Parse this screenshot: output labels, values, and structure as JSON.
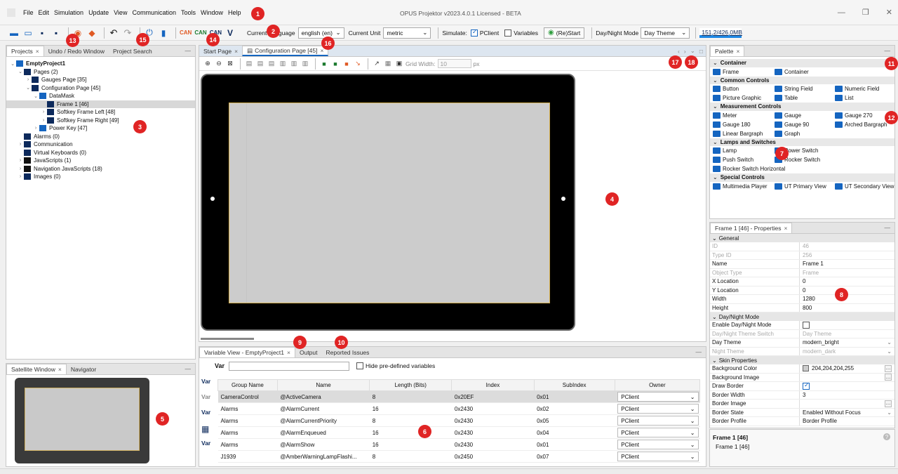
{
  "window": {
    "title": "OPUS Projektor v2023.4.0.1 Licensed - BETA"
  },
  "menu": [
    "File",
    "Edit",
    "Simulation",
    "Update",
    "View",
    "Communication",
    "Tools",
    "Window",
    "Help"
  ],
  "toolbar": {
    "can_labels": [
      "CAN",
      "CAN",
      "CAN"
    ],
    "language_label": "Current Language",
    "language_value": "english (en)",
    "unit_label": "Current Unit",
    "unit_value": "metric",
    "simulate_label": "Simulate:",
    "pclient_label": "PClient",
    "variables_label": "Variables",
    "restart_label": "(Re)Start",
    "daynight_label": "Day/Night Mode",
    "daynight_value": "Day Theme",
    "memory": "151,2/426,0MB"
  },
  "badges": [
    "1",
    "2",
    "3",
    "4",
    "5",
    "6",
    "7",
    "8",
    "9",
    "10",
    "11",
    "12",
    "13",
    "14",
    "15",
    "16",
    "17",
    "18"
  ],
  "projects": {
    "tabs": [
      "Projects",
      "Undo / Redo Window",
      "Project Search"
    ],
    "tree": [
      {
        "label": "EmptyProject1",
        "bold": true
      },
      {
        "label": "Pages (2)"
      },
      {
        "label": "Gauges Page [35]"
      },
      {
        "label": "Configuration Page [45]"
      },
      {
        "label": "DataMask"
      },
      {
        "label": "Frame 1 [46]"
      },
      {
        "label": "Softkey Frame Left [48]"
      },
      {
        "label": "Softkey Frame Right [49]"
      },
      {
        "label": "Power Key [47]"
      },
      {
        "label": "Alarms (0)"
      },
      {
        "label": "Communication"
      },
      {
        "label": "Virtual Keyboards (0)"
      },
      {
        "label": "JavaScripts (1)"
      },
      {
        "label": "Navigation JavaScripts (18)"
      },
      {
        "label": "Images (0)"
      }
    ]
  },
  "satellite": {
    "tabs": [
      "Satellite Window",
      "Navigator"
    ]
  },
  "editor": {
    "tabs": [
      "Start Page",
      "Configuration Page [45]"
    ],
    "grid_label": "Grid Width:",
    "grid_value": "10",
    "grid_unit": "px"
  },
  "bottom": {
    "tabs": [
      "Variable View - EmptyProject1",
      "Output",
      "Reported Issues"
    ],
    "var_label": "Var",
    "hide_label": "Hide pre-defined variables",
    "columns": [
      "Group Name",
      "Name",
      "Length (Bits)",
      "Index",
      "SubIndex",
      "Owner"
    ],
    "rows": [
      [
        "CameraControl",
        "@ActiveCamera",
        "8",
        "0x20EF",
        "0x01",
        "PClient"
      ],
      [
        "Alarms",
        "@AlarmCurrent",
        "16",
        "0x2430",
        "0x02",
        "PClient"
      ],
      [
        "Alarms",
        "@AlarmCurrentPriority",
        "8",
        "0x2430",
        "0x05",
        "PClient"
      ],
      [
        "Alarms",
        "@AlarmEnqueued",
        "16",
        "0x2430",
        "0x04",
        "PClient"
      ],
      [
        "Alarms",
        "@AlarmShow",
        "16",
        "0x2430",
        "0x01",
        "PClient"
      ],
      [
        "J1939",
        "@AmberWarningLampFlashi...",
        "8",
        "0x2450",
        "0x07",
        "PClient"
      ]
    ]
  },
  "palette": {
    "tab": "Palette",
    "sections": [
      {
        "title": "Container",
        "rows": [
          [
            "Frame",
            "Container"
          ]
        ]
      },
      {
        "title": "Common Controls",
        "rows": [
          [
            "Button",
            "String Field",
            "Numeric Field"
          ],
          [
            "Picture Graphic",
            "Table",
            "List"
          ]
        ]
      },
      {
        "title": "Measurement Controls",
        "rows": [
          [
            "Meter",
            "Gauge",
            "Gauge 270"
          ],
          [
            "Gauge 180",
            "Gauge 90",
            "Arched Bargraph"
          ],
          [
            "Linear Bargraph",
            "Graph"
          ]
        ]
      },
      {
        "title": "Lamps and Switches",
        "rows": [
          [
            "Lamp",
            "Power Switch"
          ],
          [
            "Push Switch",
            "Rocker Switch"
          ],
          [
            "Rocker Switch Horizontal"
          ]
        ]
      },
      {
        "title": "Special Controls",
        "rows": [
          [
            "Multimedia Player",
            "UT Primary View",
            "UT Secondary View"
          ]
        ]
      }
    ]
  },
  "properties": {
    "tab": "Frame 1 [46] - Properties",
    "rows": [
      {
        "section": "General"
      },
      {
        "k": "ID",
        "v": "46",
        "dis": true
      },
      {
        "k": "Type ID",
        "v": "256",
        "dis": true
      },
      {
        "k": "Name",
        "v": "Frame 1"
      },
      {
        "k": "Object Type",
        "v": "Frame",
        "dis": true
      },
      {
        "k": "X Location",
        "v": "0"
      },
      {
        "k": "Y Location",
        "v": "0"
      },
      {
        "k": "Width",
        "v": "1280"
      },
      {
        "k": "Height",
        "v": "800"
      },
      {
        "section": "Day/Night Mode"
      },
      {
        "k": "Enable Day/Night Mode",
        "v": "",
        "chk": false
      },
      {
        "k": "Day/Night Theme Switch",
        "v": "Day Theme",
        "dis": true
      },
      {
        "k": "Day Theme",
        "v": "modern_bright",
        "drop": true
      },
      {
        "k": "Night Theme",
        "v": "modern_dark",
        "dis": true,
        "drop": true
      },
      {
        "section": "Skin Properties"
      },
      {
        "k": "Background Color",
        "v": "204,204,204,255",
        "swatch": true,
        "dots": true
      },
      {
        "k": "Background Image",
        "v": "",
        "dots": true
      },
      {
        "k": "Draw Border",
        "v": "",
        "chk": true
      },
      {
        "k": "Border Width",
        "v": "3"
      },
      {
        "k": "Border Image",
        "v": "",
        "dots": true
      },
      {
        "k": "Border State",
        "v": "Enabled Without Focus",
        "drop": true
      },
      {
        "k": "Border Profile",
        "v": "Border Profile"
      }
    ],
    "info_title": "Frame 1 [46]",
    "info_text": "Frame 1 [46]"
  },
  "colors": {
    "accent": "#1565c0",
    "badge": "#e02424",
    "canvas": "#cccccc",
    "bezel": "#000000"
  }
}
